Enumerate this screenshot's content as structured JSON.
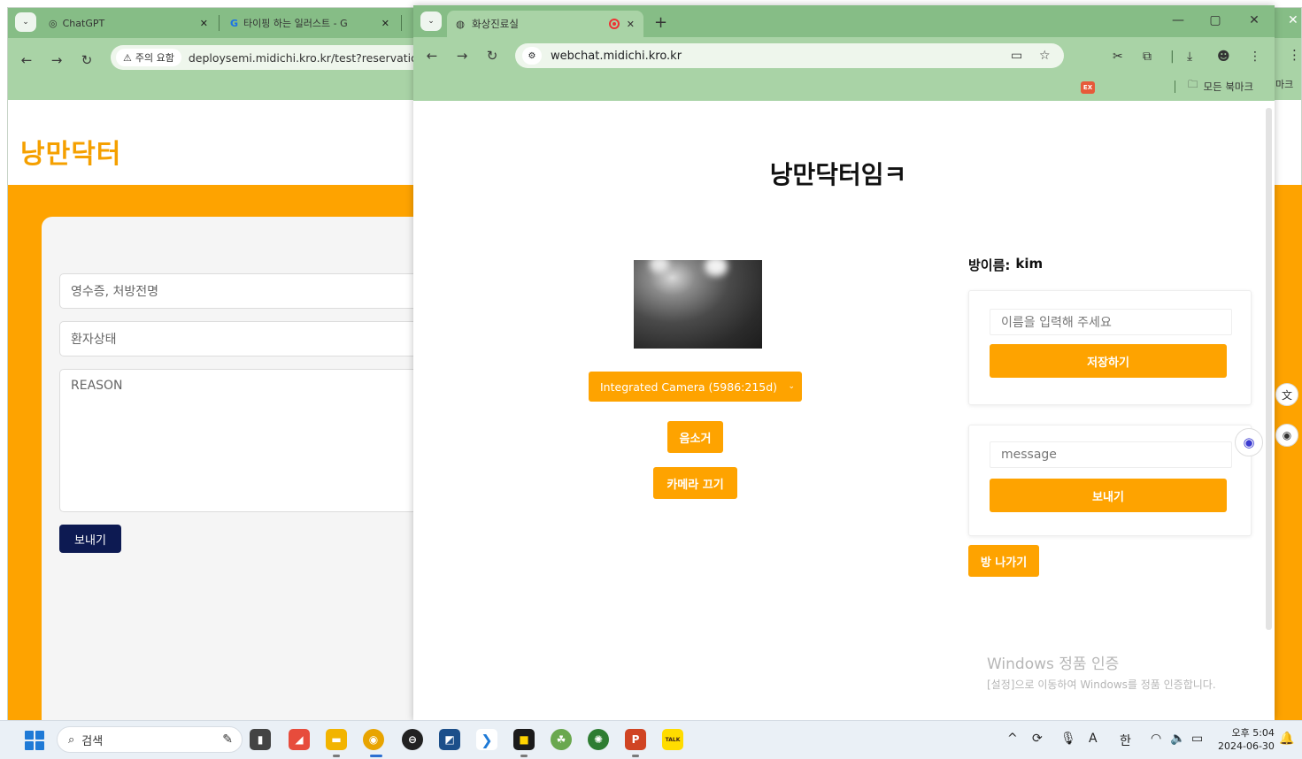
{
  "bg_browser": {
    "tabs": [
      {
        "title": "ChatGPT"
      },
      {
        "title": "타이핑 하는 일러스트 - G"
      }
    ],
    "security_chip": "주의 요함",
    "url": "deploysemi.midichi.kro.kr/test?reservation",
    "right_bookmark_fragment": "마크"
  },
  "bg_page": {
    "brand": "낭만닥터",
    "fields": {
      "receipt_placeholder": "영수증, 처방전명",
      "status_placeholder": "환자상태",
      "reason_placeholder": "REASON"
    },
    "send_label": "보내기"
  },
  "fg_browser": {
    "tab_title": "화상진료실",
    "url": "webchat.midichi.kro.kr",
    "ext_badge": "EX",
    "bookmarks_label": "모든 북마크"
  },
  "fg_page": {
    "title": "낭만닥터임ㅋ",
    "camera_select": "Integrated Camera (5986:215d)",
    "mute_label": "음소거",
    "camera_off_label": "카메라 끄기",
    "room_label": "방이름:",
    "room_value": "kim",
    "name_placeholder": "이름을 입력해 주세요",
    "save_label": "저장하기",
    "message_placeholder": "message",
    "send_label": "보내기",
    "leave_label": "방 나가기",
    "activation_title": "Windows 정품 인증",
    "activation_subtitle": "[설정]으로 이동하여 Windows를 정품 인증합니다."
  },
  "taskbar": {
    "search_label": "검색",
    "ime_mode": "A",
    "ime_lang": "한",
    "time": "오후 5:04",
    "date": "2024-06-30",
    "app_badge_ppt": "P",
    "app_badge_kakao": "TALK"
  },
  "colors": {
    "accent_orange": "#fea300",
    "brand_orange": "#f5a000",
    "navy_button": "#0d1a52",
    "chrome_green": "#86bd86",
    "chrome_toolbar": "#a9d3a6"
  }
}
